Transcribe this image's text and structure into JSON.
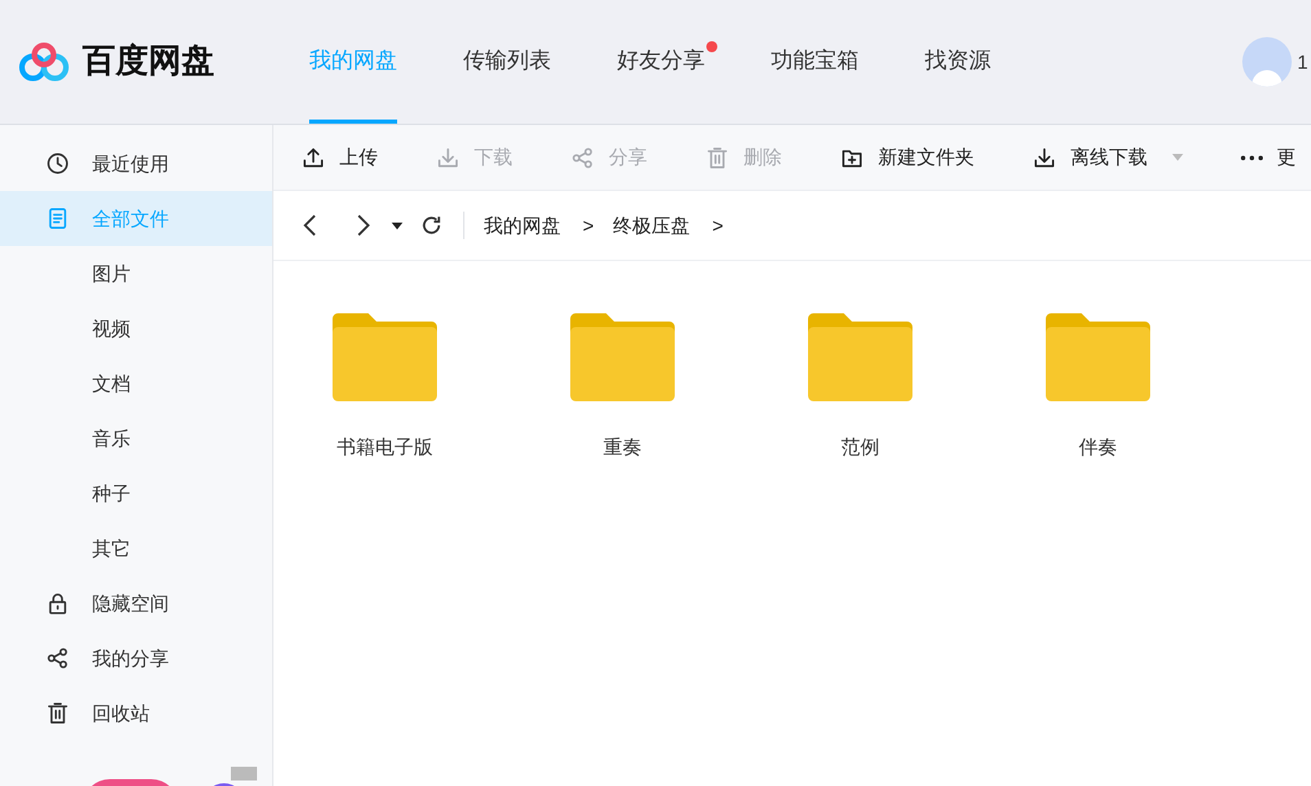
{
  "app": {
    "name": "百度网盘"
  },
  "nav_tabs": [
    {
      "label": "我的网盘",
      "selected": true,
      "badge": false
    },
    {
      "label": "传输列表",
      "selected": false,
      "badge": false
    },
    {
      "label": "好友分享",
      "selected": false,
      "badge": true
    },
    {
      "label": "功能宝箱",
      "selected": false,
      "badge": false
    },
    {
      "label": "找资源",
      "selected": false,
      "badge": false
    }
  ],
  "user": {
    "name": "1"
  },
  "sidebar": {
    "items": [
      {
        "kind": "clock",
        "label": "最近使用",
        "selected": false
      },
      {
        "kind": "file",
        "label": "全部文件",
        "selected": true,
        "children": [
          {
            "label": "图片",
            "selected": false
          },
          {
            "label": "视频",
            "selected": false
          },
          {
            "label": "文档",
            "selected": false
          },
          {
            "label": "音乐",
            "selected": false
          },
          {
            "label": "种子",
            "selected": false
          },
          {
            "label": "其它",
            "selected": false
          }
        ]
      },
      {
        "kind": "lock",
        "label": "隐藏空间",
        "selected": false
      },
      {
        "kind": "share",
        "label": "我的分享",
        "selected": false
      },
      {
        "kind": "trash",
        "label": "回收站",
        "selected": false
      }
    ]
  },
  "toolbar": [
    {
      "kind": "upload",
      "label": "上传",
      "disabled": false
    },
    {
      "kind": "download",
      "label": "下载",
      "disabled": true
    },
    {
      "kind": "share",
      "label": "分享",
      "disabled": true
    },
    {
      "kind": "trash",
      "label": "删除",
      "disabled": true
    },
    {
      "kind": "new-folder",
      "label": "新建文件夹",
      "disabled": false
    },
    {
      "kind": "offline",
      "label": "离线下载",
      "disabled": false
    },
    {
      "kind": "more",
      "label": "更",
      "disabled": false
    }
  ],
  "breadcrumb": {
    "items": [
      "我的网盘",
      "终极压盘"
    ],
    "separator": ">"
  },
  "folders": [
    {
      "name": "书籍电子版"
    },
    {
      "name": "重奏"
    },
    {
      "name": "范例"
    },
    {
      "name": "伴奏"
    }
  ]
}
